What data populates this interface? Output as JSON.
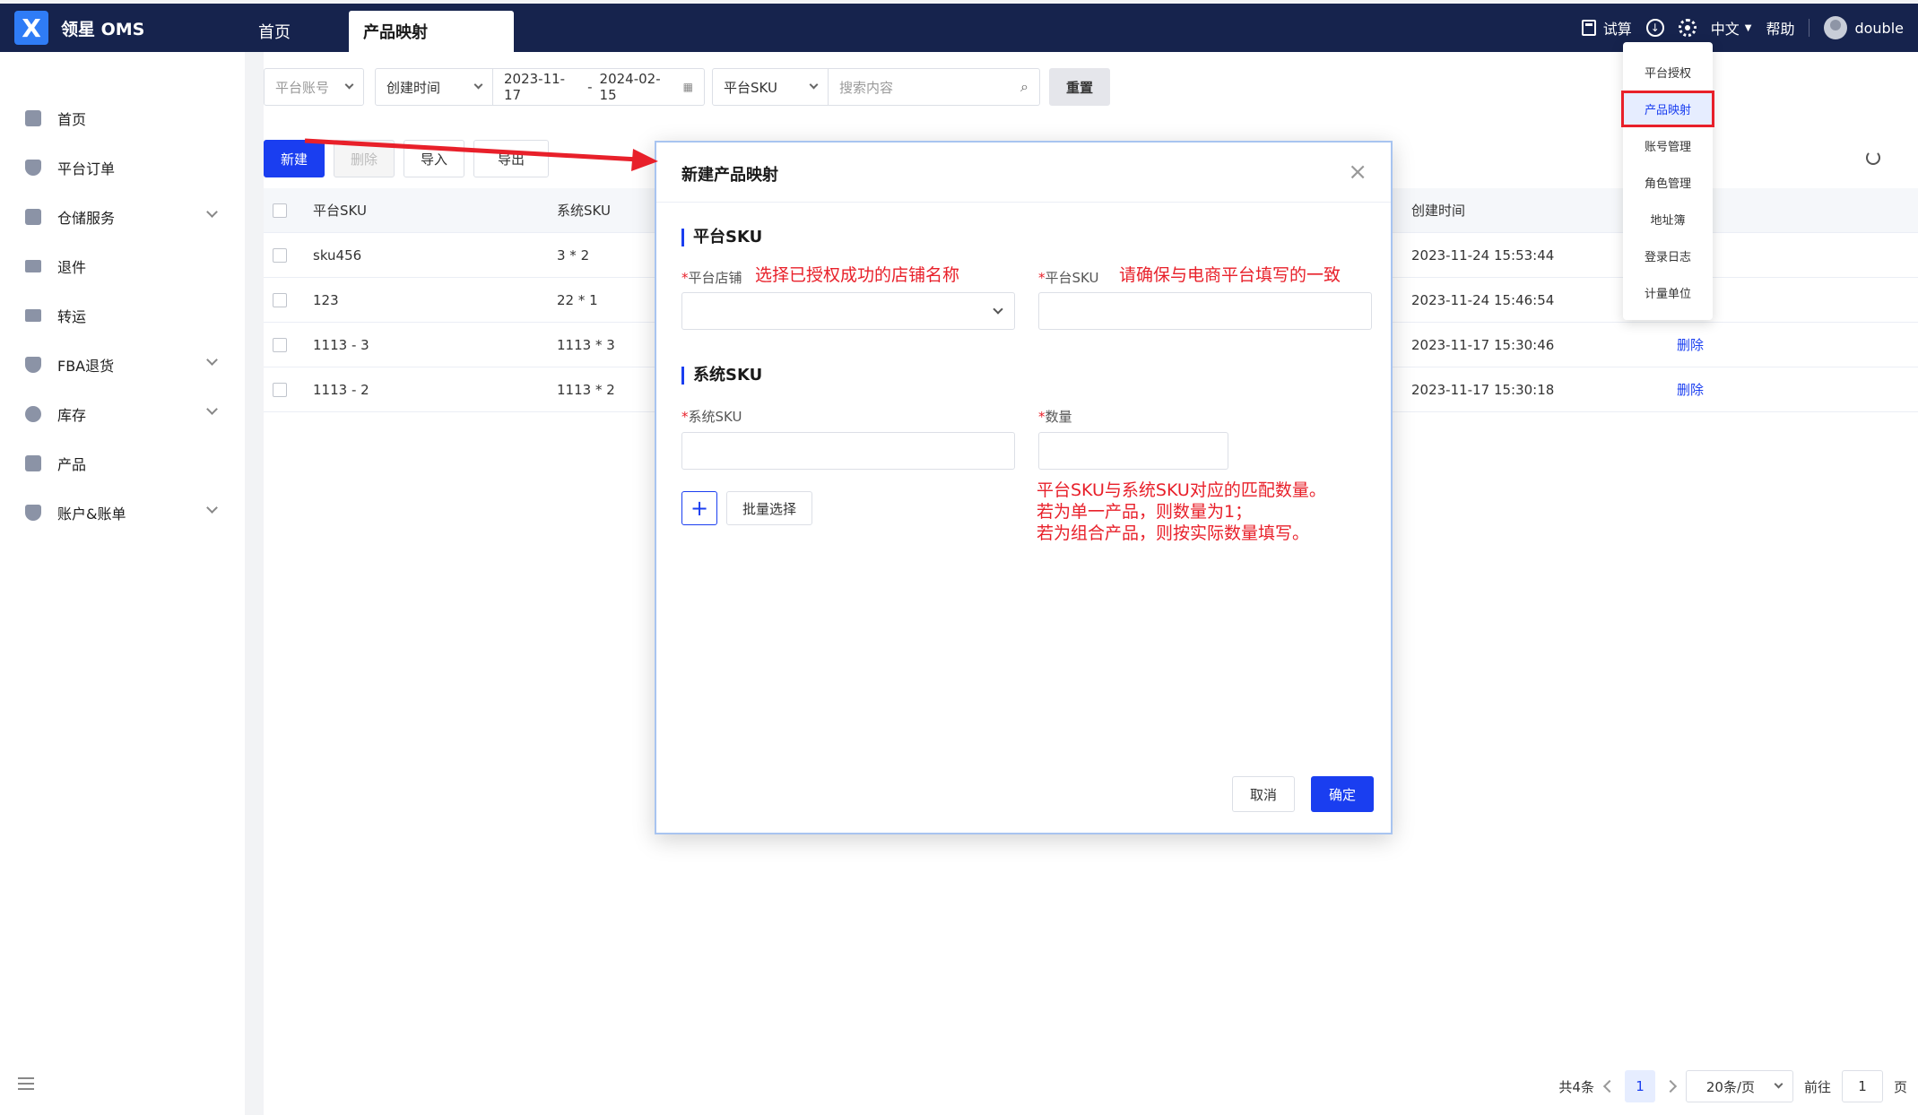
{
  "app": {
    "logo_glyph": "X",
    "name": "领星 OMS"
  },
  "tabs": [
    {
      "label": "首页",
      "active": false
    },
    {
      "label": "产品映射",
      "active": true
    }
  ],
  "header_right": {
    "trial_label": "试算",
    "language": "中文",
    "help": "帮助",
    "user": "double"
  },
  "sidebar": {
    "items": [
      {
        "label": "首页",
        "icon": "home-icon",
        "expandable": false
      },
      {
        "label": "平台订单",
        "icon": "shield-icon",
        "expandable": false
      },
      {
        "label": "仓储服务",
        "icon": "warehouse-icon",
        "expandable": true
      },
      {
        "label": "退件",
        "icon": "truck-icon",
        "expandable": false
      },
      {
        "label": "转运",
        "icon": "truck-icon",
        "expandable": false
      },
      {
        "label": "FBA退货",
        "icon": "shield-icon",
        "expandable": true
      },
      {
        "label": "库存",
        "icon": "pie-chart-icon",
        "expandable": true
      },
      {
        "label": "产品",
        "icon": "box-icon",
        "expandable": false
      },
      {
        "label": "账户&账单",
        "icon": "shield-icon",
        "expandable": true
      }
    ]
  },
  "filters": {
    "platform_account_placeholder": "平台账号",
    "time_type": "创建时间",
    "date_start": "2023-11-17",
    "date_sep": "-",
    "date_end": "2024-02-15",
    "search_field": "平台SKU",
    "search_placeholder": "搜索内容",
    "reset_label": "重置"
  },
  "toolbar": {
    "new_label": "新建",
    "delete_label": "删除",
    "import_label": "导入",
    "export_label": "导出"
  },
  "table": {
    "headers": {
      "platform_sku": "平台SKU",
      "system_sku": "系统SKU",
      "created_at": "创建时间"
    },
    "rows": [
      {
        "platform_sku": "sku456",
        "system_sku": "3 * 2",
        "created_at": "2023-11-24 15:53:44",
        "action": ""
      },
      {
        "platform_sku": "123",
        "system_sku": "22 * 1",
        "created_at": "2023-11-24 15:46:54",
        "action": ""
      },
      {
        "platform_sku": "1113 - 3",
        "system_sku": "1113 * 3",
        "created_at": "2023-11-17 15:30:46",
        "action": "删除"
      },
      {
        "platform_sku": "1113 - 2",
        "system_sku": "1113 * 2",
        "created_at": "2023-11-17 15:30:18",
        "action": "删除"
      }
    ]
  },
  "pagination": {
    "total": "共4条",
    "current_page": "1",
    "page_size": "20条/页",
    "goto_prefix": "前往",
    "goto_value": "1",
    "goto_suffix": "页"
  },
  "settings_menu": {
    "items": [
      {
        "label": "平台授权",
        "active": false
      },
      {
        "label": "产品映射",
        "active": true
      },
      {
        "label": "账号管理",
        "active": false
      },
      {
        "label": "角色管理",
        "active": false
      },
      {
        "label": "地址簿",
        "active": false
      },
      {
        "label": "登录日志",
        "active": false
      },
      {
        "label": "计量单位",
        "active": false
      }
    ]
  },
  "modal": {
    "title": "新建产品映射",
    "close_glyph": "×",
    "section_platform": "平台SKU",
    "store_label": "平台店铺",
    "store_hint": "选择已授权成功的店铺名称",
    "platform_sku_label": "平台SKU",
    "platform_sku_hint": "请确保与电商平台填写的一致",
    "section_system": "系统SKU",
    "system_sku_label": "系统SKU",
    "qty_label": "数量",
    "qty_hint_1": "平台SKU与系统SKU对应的匹配数量。",
    "qty_hint_2": "若为单一产品，则数量为1；",
    "qty_hint_3": "若为组合产品，则按实际数量填写。",
    "add_glyph": "+",
    "batch_label": "批量选择",
    "cancel_label": "取消",
    "ok_label": "确定",
    "required_mark": "*"
  },
  "colors": {
    "header_bg": "#16234d",
    "primary": "#1a3ef0",
    "annotation_red": "#e8202a"
  }
}
